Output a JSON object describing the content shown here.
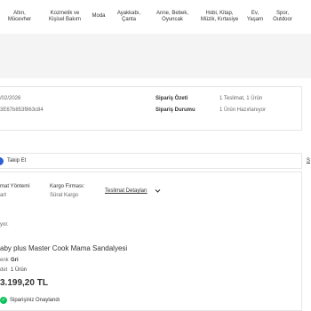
{
  "nav": {
    "items": [
      "Altın,\nMücevher",
      "Kozmetik ve\nKişisel Bakım",
      "Moda",
      "Ayakkabı,\nÇanta",
      "Anne, Bebek,\nOyuncak",
      "Hobi, Kitap,\nMüzik, Kırtasiye",
      "Ev,\nYaşam",
      "Spor,\nOutdoor"
    ]
  },
  "order": {
    "date": "/02/2026",
    "order_no": "3E67b853f863c84",
    "summary_label": "Sipariş Özeti",
    "summary_value": "1 Teslimat, 1 Ürün",
    "status_label": "Sipariş Durumu",
    "status_value": "1 Ürün Hazırlanıyor"
  },
  "follow": {
    "label": "Takip Et",
    "right_link": "S"
  },
  "delivery": {
    "method_label": "mat Yöntemi",
    "method_value": "art",
    "carrier_label": "Kargo Firması:",
    "carrier_value": "Sürat Kargo",
    "details_link": "Teslimat Detayları"
  },
  "status_note": "yor.",
  "product": {
    "title": "aby plus Master Cook Mama Sandalyesi",
    "color_label": "enk",
    "color_value": "Gri",
    "qty_label": "det",
    "qty_value": "1 Ürün",
    "price": "3.199,20 TL",
    "confirmed": "Siparişiniz Onaylandı"
  },
  "colors": {
    "accent_blue": "#2d5fd7",
    "success_green": "#0bc15c"
  }
}
